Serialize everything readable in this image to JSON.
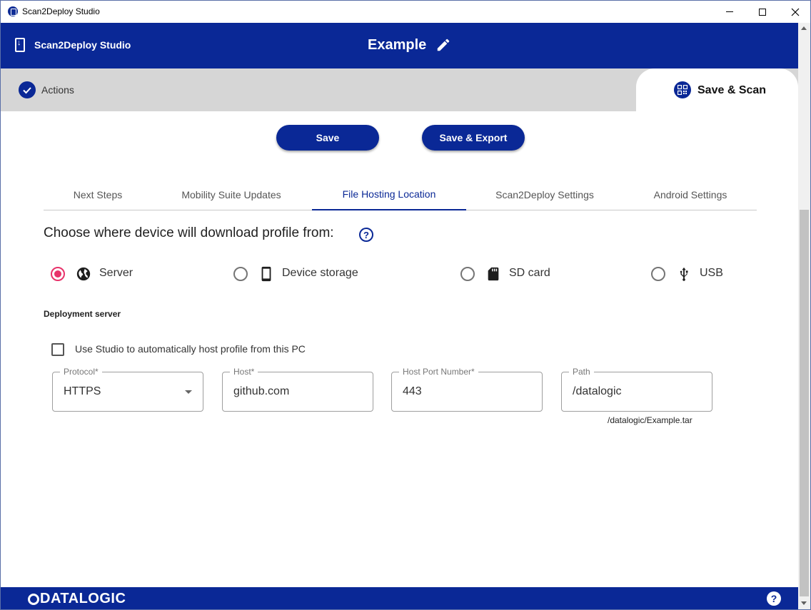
{
  "window": {
    "title": "Scan2Deploy Studio"
  },
  "header": {
    "brand": "Scan2Deploy Studio",
    "project_name": "Example"
  },
  "stepper": {
    "steps": [
      {
        "label": "Actions",
        "state": "completed"
      },
      {
        "label": "Save & Scan",
        "state": "active"
      }
    ]
  },
  "actions": {
    "save_label": "Save",
    "save_export_label": "Save & Export"
  },
  "tabs": [
    {
      "label": "Next Steps",
      "active": false
    },
    {
      "label": "Mobility Suite Updates",
      "active": false
    },
    {
      "label": "File Hosting Location",
      "active": true
    },
    {
      "label": "Scan2Deploy Settings",
      "active": false
    },
    {
      "label": "Android Settings",
      "active": false
    }
  ],
  "hosting": {
    "heading": "Choose where device will download profile from:",
    "options": [
      {
        "label": "Server",
        "icon": "globe-icon",
        "selected": true
      },
      {
        "label": "Device storage",
        "icon": "phone-icon",
        "selected": false
      },
      {
        "label": "SD card",
        "icon": "sd-card-icon",
        "selected": false
      },
      {
        "label": "USB",
        "icon": "usb-icon",
        "selected": false
      }
    ],
    "section_label": "Deployment server",
    "auto_host_label": "Use Studio to automatically host profile from this PC",
    "auto_host_checked": false,
    "fields": {
      "protocol": {
        "label": "Protocol*",
        "value": "HTTPS"
      },
      "host": {
        "label": "Host*",
        "value": "github.com"
      },
      "port": {
        "label": "Host Port Number*",
        "value": "443"
      },
      "path": {
        "label": "Path",
        "value": "/datalogic",
        "helper": "/datalogic/Example.tar"
      }
    }
  },
  "footer": {
    "logo_text": "DATALOGIC"
  },
  "colors": {
    "primary": "#0a2896",
    "radio_selected": "#e8336b",
    "stepper_band": "#d6d6d6"
  }
}
